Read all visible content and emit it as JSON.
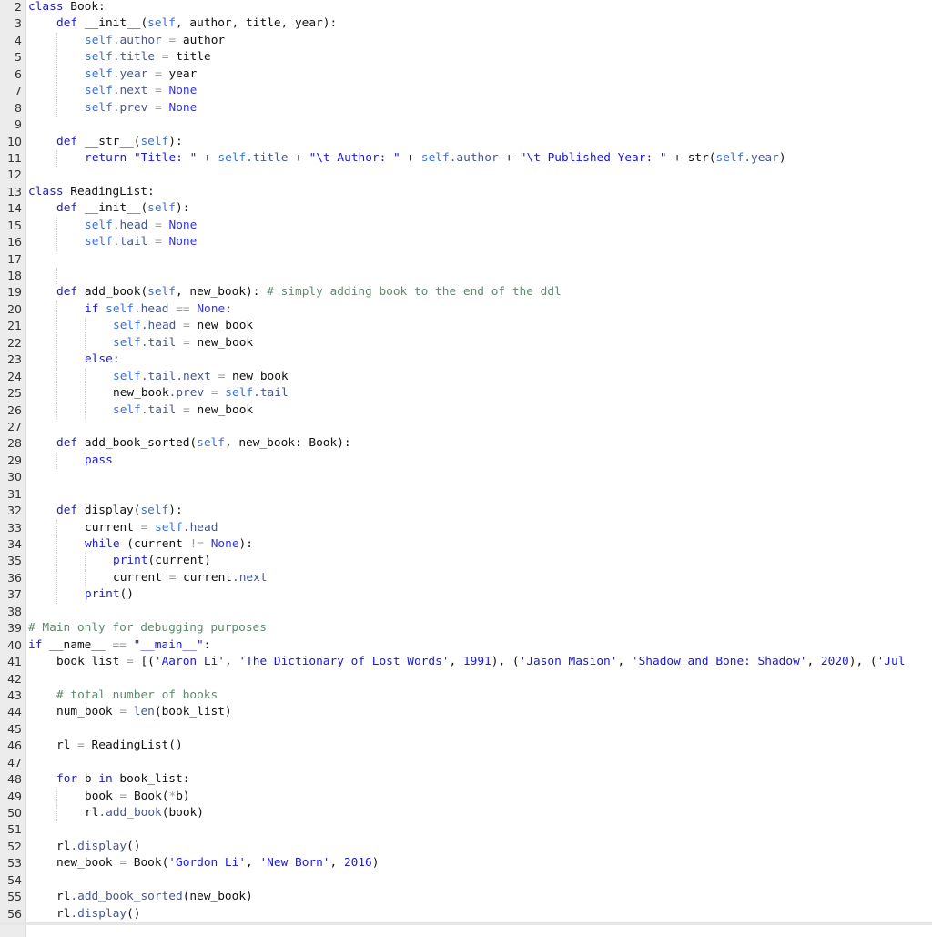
{
  "colors": {
    "keyword": "#2020cc",
    "self": "#3c72d6",
    "attribute": "#47578f",
    "string": "#1818e0",
    "comment": "#5d8a6c",
    "gutter": "#ececec"
  },
  "lines": [
    {
      "n": "2",
      "ind": 0,
      "t": [
        [
          "k",
          "class"
        ],
        [
          "p",
          " Book:"
        ]
      ]
    },
    {
      "n": "3",
      "ind": 1,
      "t": [
        [
          "k",
          "def"
        ],
        [
          "p",
          " __init__("
        ],
        [
          "s",
          "self"
        ],
        [
          "p",
          ", author, title, year):"
        ]
      ]
    },
    {
      "n": "4",
      "ind": 2,
      "t": [
        [
          "s",
          "self"
        ],
        [
          "a",
          ".author"
        ],
        [
          "o",
          " = "
        ],
        [
          "p",
          "author"
        ]
      ]
    },
    {
      "n": "5",
      "ind": 2,
      "t": [
        [
          "s",
          "self"
        ],
        [
          "a",
          ".title"
        ],
        [
          "o",
          " = "
        ],
        [
          "p",
          "title"
        ]
      ]
    },
    {
      "n": "6",
      "ind": 2,
      "t": [
        [
          "s",
          "self"
        ],
        [
          "a",
          ".year"
        ],
        [
          "o",
          " = "
        ],
        [
          "p",
          "year"
        ]
      ]
    },
    {
      "n": "7",
      "ind": 2,
      "t": [
        [
          "s",
          "self"
        ],
        [
          "a",
          ".next"
        ],
        [
          "o",
          " = "
        ],
        [
          "n",
          "None"
        ]
      ]
    },
    {
      "n": "8",
      "ind": 2,
      "t": [
        [
          "s",
          "self"
        ],
        [
          "a",
          ".prev"
        ],
        [
          "o",
          " = "
        ],
        [
          "n",
          "None"
        ]
      ]
    },
    {
      "n": "9",
      "ind": 0,
      "t": []
    },
    {
      "n": "10",
      "ind": 1,
      "t": [
        [
          "k",
          "def"
        ],
        [
          "p",
          " __str__("
        ],
        [
          "s",
          "self"
        ],
        [
          "p",
          "):"
        ]
      ]
    },
    {
      "n": "11",
      "ind": 2,
      "t": [
        [
          "k",
          "return"
        ],
        [
          "t",
          " \"Title: \""
        ],
        [
          "p",
          " + "
        ],
        [
          "s",
          "self"
        ],
        [
          "a",
          ".title"
        ],
        [
          "p",
          " + "
        ],
        [
          "t",
          "\"\\t Author: \""
        ],
        [
          "p",
          " + "
        ],
        [
          "s",
          "self"
        ],
        [
          "a",
          ".author"
        ],
        [
          "p",
          " + "
        ],
        [
          "t",
          "\"\\t Published Year: \""
        ],
        [
          "p",
          " + str("
        ],
        [
          "s",
          "self"
        ],
        [
          "a",
          ".year"
        ],
        [
          "p",
          ")"
        ]
      ]
    },
    {
      "n": "12",
      "ind": 0,
      "t": []
    },
    {
      "n": "13",
      "ind": 0,
      "t": [
        [
          "k",
          "class"
        ],
        [
          "p",
          " ReadingList:"
        ]
      ]
    },
    {
      "n": "14",
      "ind": 1,
      "t": [
        [
          "k",
          "def"
        ],
        [
          "p",
          " __init__("
        ],
        [
          "s",
          "self"
        ],
        [
          "p",
          "):"
        ]
      ]
    },
    {
      "n": "15",
      "ind": 2,
      "t": [
        [
          "s",
          "self"
        ],
        [
          "a",
          ".head"
        ],
        [
          "o",
          " = "
        ],
        [
          "n",
          "None"
        ]
      ]
    },
    {
      "n": "16",
      "ind": 2,
      "t": [
        [
          "s",
          "self"
        ],
        [
          "a",
          ".tail"
        ],
        [
          "o",
          " = "
        ],
        [
          "n",
          "None"
        ]
      ]
    },
    {
      "n": "17",
      "ind": 0,
      "t": []
    },
    {
      "n": "18",
      "ind": 2,
      "t": []
    },
    {
      "n": "19",
      "ind": 1,
      "t": [
        [
          "k",
          "def"
        ],
        [
          "p",
          " add_book("
        ],
        [
          "s",
          "self"
        ],
        [
          "p",
          ", new_book): "
        ],
        [
          "c",
          "# simply adding book to the end of the ddl"
        ]
      ]
    },
    {
      "n": "20",
      "ind": 2,
      "t": [
        [
          "k",
          "if"
        ],
        [
          "p",
          " "
        ],
        [
          "s",
          "self"
        ],
        [
          "a",
          ".head"
        ],
        [
          "o",
          " == "
        ],
        [
          "n",
          "None"
        ],
        [
          "p",
          ":"
        ]
      ]
    },
    {
      "n": "21",
      "ind": 3,
      "t": [
        [
          "s",
          "self"
        ],
        [
          "a",
          ".head"
        ],
        [
          "o",
          " = "
        ],
        [
          "p",
          "new_book"
        ]
      ]
    },
    {
      "n": "22",
      "ind": 3,
      "t": [
        [
          "s",
          "self"
        ],
        [
          "a",
          ".tail"
        ],
        [
          "o",
          " = "
        ],
        [
          "p",
          "new_book"
        ]
      ]
    },
    {
      "n": "23",
      "ind": 2,
      "t": [
        [
          "k",
          "else"
        ],
        [
          "p",
          ":"
        ]
      ]
    },
    {
      "n": "24",
      "ind": 3,
      "t": [
        [
          "s",
          "self"
        ],
        [
          "a",
          ".tail.next"
        ],
        [
          "o",
          " = "
        ],
        [
          "p",
          "new_book"
        ]
      ]
    },
    {
      "n": "25",
      "ind": 3,
      "t": [
        [
          "p",
          "new_book"
        ],
        [
          "a",
          ".prev"
        ],
        [
          "o",
          " = "
        ],
        [
          "s",
          "self"
        ],
        [
          "a",
          ".tail"
        ]
      ]
    },
    {
      "n": "26",
      "ind": 3,
      "t": [
        [
          "s",
          "self"
        ],
        [
          "a",
          ".tail"
        ],
        [
          "o",
          " = "
        ],
        [
          "p",
          "new_book"
        ]
      ]
    },
    {
      "n": "27",
      "ind": 0,
      "t": []
    },
    {
      "n": "28",
      "ind": 1,
      "t": [
        [
          "k",
          "def"
        ],
        [
          "p",
          " add_book_sorted("
        ],
        [
          "s",
          "self"
        ],
        [
          "p",
          ", new_book: Book):"
        ]
      ]
    },
    {
      "n": "29",
      "ind": 2,
      "t": [
        [
          "k",
          "pass"
        ]
      ]
    },
    {
      "n": "30",
      "ind": 0,
      "t": []
    },
    {
      "n": "31",
      "ind": 0,
      "t": []
    },
    {
      "n": "32",
      "ind": 1,
      "t": [
        [
          "k",
          "def"
        ],
        [
          "p",
          " display("
        ],
        [
          "s",
          "self"
        ],
        [
          "p",
          "):"
        ]
      ]
    },
    {
      "n": "33",
      "ind": 2,
      "t": [
        [
          "p",
          "current"
        ],
        [
          "o",
          " = "
        ],
        [
          "s",
          "self"
        ],
        [
          "a",
          ".head"
        ]
      ]
    },
    {
      "n": "34",
      "ind": 2,
      "t": [
        [
          "k",
          "while"
        ],
        [
          "p",
          " (current "
        ],
        [
          "o",
          "!="
        ],
        [
          "p",
          " "
        ],
        [
          "n",
          "None"
        ],
        [
          "p",
          "):"
        ]
      ]
    },
    {
      "n": "35",
      "ind": 3,
      "t": [
        [
          "k",
          "print"
        ],
        [
          "p",
          "(current)"
        ]
      ]
    },
    {
      "n": "36",
      "ind": 3,
      "t": [
        [
          "p",
          "current"
        ],
        [
          "o",
          " = "
        ],
        [
          "p",
          "current"
        ],
        [
          "a",
          ".next"
        ]
      ]
    },
    {
      "n": "37",
      "ind": 2,
      "t": [
        [
          "k",
          "print"
        ],
        [
          "p",
          "()"
        ]
      ]
    },
    {
      "n": "38",
      "ind": 0,
      "t": []
    },
    {
      "n": "39",
      "ind": 0,
      "t": [
        [
          "c",
          "# Main only for debugging purposes"
        ]
      ]
    },
    {
      "n": "40",
      "ind": 0,
      "t": [
        [
          "k",
          "if"
        ],
        [
          "p",
          " __name__ "
        ],
        [
          "o",
          "=="
        ],
        [
          "p",
          " "
        ],
        [
          "t",
          "\"__main__\""
        ],
        [
          "p",
          ":"
        ]
      ]
    },
    {
      "n": "41",
      "ind": 1,
      "t": [
        [
          "p",
          "book_list"
        ],
        [
          "o",
          " = "
        ],
        [
          "p",
          "[("
        ],
        [
          "t",
          "'Aaron Li'"
        ],
        [
          "p",
          ", "
        ],
        [
          "t",
          "'The Dictionary of Lost Words'"
        ],
        [
          "p",
          ", "
        ],
        [
          "t",
          "1991"
        ],
        [
          "p",
          "), ("
        ],
        [
          "t",
          "'Jason Masion'"
        ],
        [
          "p",
          ", "
        ],
        [
          "t",
          "'Shadow and Bone: Shadow'"
        ],
        [
          "p",
          ", "
        ],
        [
          "t",
          "2020"
        ],
        [
          "p",
          "), ("
        ],
        [
          "t",
          "'Jul"
        ]
      ]
    },
    {
      "n": "42",
      "ind": 0,
      "t": []
    },
    {
      "n": "43",
      "ind": 1,
      "t": [
        [
          "c",
          "# total number of books"
        ]
      ]
    },
    {
      "n": "44",
      "ind": 1,
      "t": [
        [
          "p",
          "num_book"
        ],
        [
          "o",
          " = "
        ],
        [
          "a",
          "len"
        ],
        [
          "p",
          "(book_list)"
        ]
      ]
    },
    {
      "n": "45",
      "ind": 0,
      "t": []
    },
    {
      "n": "46",
      "ind": 1,
      "t": [
        [
          "p",
          "rl"
        ],
        [
          "o",
          " = "
        ],
        [
          "p",
          "ReadingList()"
        ]
      ]
    },
    {
      "n": "47",
      "ind": 0,
      "t": []
    },
    {
      "n": "48",
      "ind": 1,
      "t": [
        [
          "k",
          "for"
        ],
        [
          "p",
          " b "
        ],
        [
          "k",
          "in"
        ],
        [
          "p",
          " book_list:"
        ]
      ]
    },
    {
      "n": "49",
      "ind": 2,
      "t": [
        [
          "p",
          "book"
        ],
        [
          "o",
          " = "
        ],
        [
          "p",
          "Book("
        ],
        [
          "o",
          "*"
        ],
        [
          "p",
          "b)"
        ]
      ]
    },
    {
      "n": "50",
      "ind": 2,
      "t": [
        [
          "p",
          "rl"
        ],
        [
          "a",
          ".add_book"
        ],
        [
          "p",
          "(book)"
        ]
      ]
    },
    {
      "n": "51",
      "ind": 0,
      "t": []
    },
    {
      "n": "52",
      "ind": 1,
      "t": [
        [
          "p",
          "rl"
        ],
        [
          "a",
          ".display"
        ],
        [
          "p",
          "()"
        ]
      ]
    },
    {
      "n": "53",
      "ind": 1,
      "t": [
        [
          "p",
          "new_book"
        ],
        [
          "o",
          " = "
        ],
        [
          "p",
          "Book("
        ],
        [
          "t",
          "'Gordon Li'"
        ],
        [
          "p",
          ", "
        ],
        [
          "t",
          "'New Born'"
        ],
        [
          "p",
          ", "
        ],
        [
          "t",
          "2016"
        ],
        [
          "p",
          ")"
        ]
      ]
    },
    {
      "n": "54",
      "ind": 0,
      "t": []
    },
    {
      "n": "55",
      "ind": 1,
      "t": [
        [
          "p",
          "rl"
        ],
        [
          "a",
          ".add_book_sorted"
        ],
        [
          "p",
          "(new_book)"
        ]
      ]
    },
    {
      "n": "56",
      "ind": 1,
      "t": [
        [
          "p",
          "rl"
        ],
        [
          "a",
          ".display"
        ],
        [
          "p",
          "()"
        ]
      ]
    }
  ]
}
